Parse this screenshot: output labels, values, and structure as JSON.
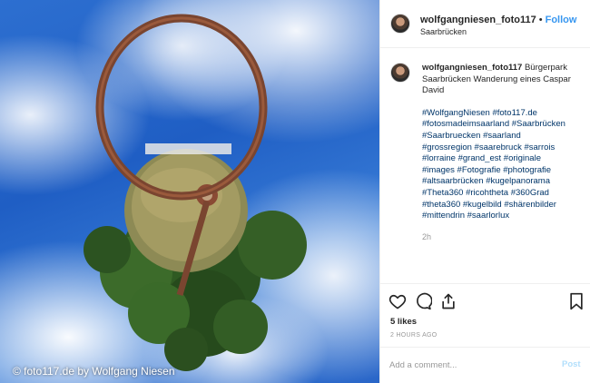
{
  "photo": {
    "watermark": "© foto117.de by Wolfgang Niesen",
    "subject": "little-planet"
  },
  "header": {
    "username": "wolfgangniesen_foto117",
    "separator": "•",
    "follow_label": "Follow",
    "location": "Saarbrücken"
  },
  "caption": {
    "username": "wolfgangniesen_foto117",
    "text": "Bürgerpark Saarbrücken Wanderung eines Caspar David",
    "hashtags": [
      "#WolfgangNiesen #foto117.de",
      "#fotosmadeimsaarland #Saarbrücken",
      "#Saarbruecken #saarland",
      "#grossregion #saarebruck #sarrois",
      "#lorraine #grand_est #originale",
      "#images #Fotografie #photografie",
      "#altsaarbrücken #kugelpanorama",
      "#Theta360 #ricohtheta #360Grad",
      "#theta360 #kugelbild #shärenbilder",
      "#mittendrin #saarlorlux"
    ],
    "time": "2h"
  },
  "actions": {
    "icons": [
      "heart-icon",
      "comment-icon",
      "share-icon",
      "bookmark-icon"
    ],
    "likes": "5 likes",
    "posted_ago": "2 HOURS AGO"
  },
  "comment": {
    "placeholder": "Add a comment...",
    "post_label": "Post"
  },
  "colors": {
    "link": "#003569",
    "follow": "#3897f0",
    "post_disabled": "#b2dffc",
    "sky": "#2a66c8"
  }
}
